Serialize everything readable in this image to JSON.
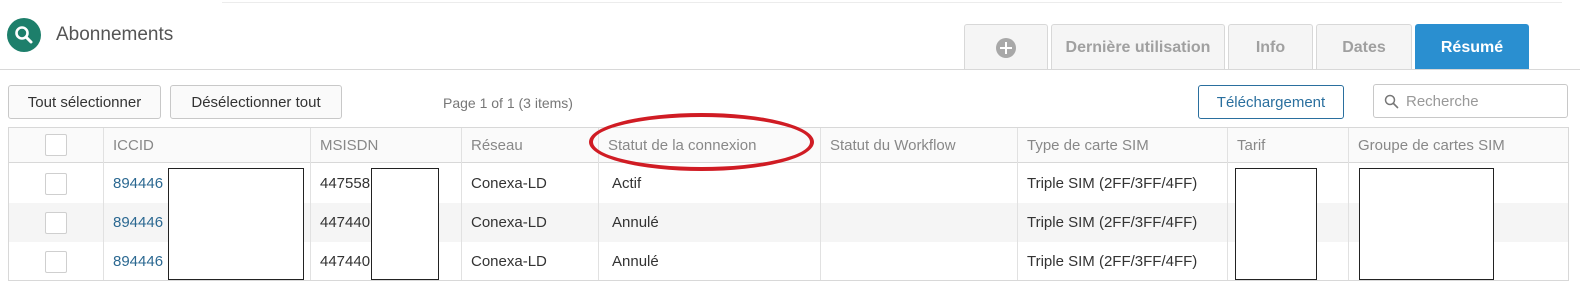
{
  "page": {
    "title": "Abonnements",
    "title_icon": "search-icon",
    "accent_color": "#1d7f6b"
  },
  "tabs": [
    {
      "label": "",
      "icon": "plus-circle-icon",
      "active": false
    },
    {
      "label": "Dernière utilisation",
      "active": false
    },
    {
      "label": "Info",
      "active": false
    },
    {
      "label": "Dates",
      "active": false
    },
    {
      "label": "Résumé",
      "active": true
    }
  ],
  "toolbar": {
    "select_all_label": "Tout sélectionner",
    "deselect_all_label": "Désélectionner tout",
    "page_info": "Page 1 of 1 (3 items)",
    "download_label": "Téléchargement",
    "search_placeholder": "Recherche",
    "search_value": ""
  },
  "table": {
    "columns": [
      "",
      "ICCID",
      "MSISDN",
      "Réseau",
      "Statut de la connexion",
      "Statut du Workflow",
      "Type de carte SIM",
      "Tarif",
      "Groupe de cartes SIM"
    ],
    "rows": [
      {
        "iccid": "894446",
        "msisdn": "447558",
        "network": "Conexa-LD",
        "connection_status": "Actif",
        "workflow_status": "",
        "sim_type": "Triple SIM (2FF/3FF/4FF)",
        "tariff": "",
        "sim_group": ""
      },
      {
        "iccid": "894446",
        "msisdn": "447440",
        "network": "Conexa-LD",
        "connection_status": "Annulé",
        "workflow_status": "",
        "sim_type": "Triple SIM (2FF/3FF/4FF)",
        "tariff": "",
        "sim_group": ""
      },
      {
        "iccid": "894446",
        "msisdn": "447440",
        "network": "Conexa-LD",
        "connection_status": "Annulé",
        "workflow_status": "",
        "sim_type": "Triple SIM (2FF/3FF/4FF)",
        "tariff": "",
        "sim_group": ""
      }
    ]
  },
  "colors": {
    "active_tab": "#2a8fd0",
    "link": "#2b6891",
    "annotation": "#d01c24",
    "download_button": "#2a6f9e"
  }
}
